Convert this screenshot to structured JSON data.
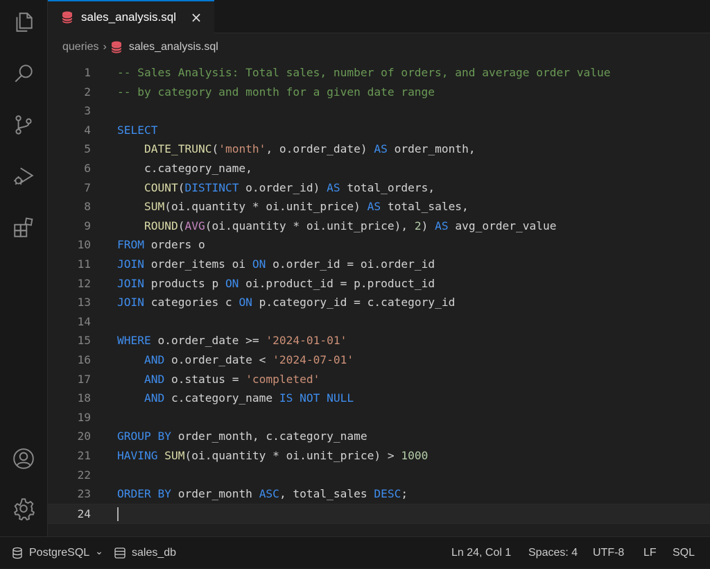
{
  "tab": {
    "filename": "sales_analysis.sql",
    "close_icon": "×"
  },
  "breadcrumb": {
    "folder": "queries",
    "separator": "›",
    "file": "sales_analysis.sql"
  },
  "activity_icons": [
    "explorer-icon",
    "search-icon",
    "source-control-icon",
    "run-debug-icon",
    "extensions-icon",
    "account-icon",
    "settings-gear-icon"
  ],
  "editor": {
    "active_line": 24,
    "lines": [
      {
        "n": "1",
        "tokens": [
          {
            "t": "-- Sales Analysis: Total sales, number of orders, and average order value",
            "c": "cm"
          }
        ]
      },
      {
        "n": "2",
        "tokens": [
          {
            "t": "-- by category and month for a given date range",
            "c": "cm"
          }
        ]
      },
      {
        "n": "3",
        "tokens": []
      },
      {
        "n": "4",
        "tokens": [
          {
            "t": "SELECT",
            "c": "kw"
          }
        ]
      },
      {
        "n": "5",
        "tokens": [
          {
            "t": "    ",
            "c": "id"
          },
          {
            "t": "DATE_TRUNC",
            "c": "fn"
          },
          {
            "t": "(",
            "c": "id"
          },
          {
            "t": "'month'",
            "c": "st"
          },
          {
            "t": ", o.order_date) ",
            "c": "id"
          },
          {
            "t": "AS",
            "c": "kw"
          },
          {
            "t": " order_month,",
            "c": "id"
          }
        ]
      },
      {
        "n": "6",
        "tokens": [
          {
            "t": "    c.category_name,",
            "c": "id"
          }
        ]
      },
      {
        "n": "7",
        "tokens": [
          {
            "t": "    ",
            "c": "id"
          },
          {
            "t": "COUNT",
            "c": "fn"
          },
          {
            "t": "(",
            "c": "id"
          },
          {
            "t": "DISTINCT",
            "c": "kw"
          },
          {
            "t": " o.order_id) ",
            "c": "id"
          },
          {
            "t": "AS",
            "c": "kw"
          },
          {
            "t": " total_orders,",
            "c": "id"
          }
        ]
      },
      {
        "n": "8",
        "tokens": [
          {
            "t": "    ",
            "c": "id"
          },
          {
            "t": "SUM",
            "c": "fn"
          },
          {
            "t": "(oi.quantity * oi.unit_price) ",
            "c": "id"
          },
          {
            "t": "AS",
            "c": "kw"
          },
          {
            "t": " total_sales,",
            "c": "id"
          }
        ]
      },
      {
        "n": "9",
        "tokens": [
          {
            "t": "    ",
            "c": "id"
          },
          {
            "t": "ROUND",
            "c": "fn"
          },
          {
            "t": "(",
            "c": "id"
          },
          {
            "t": "AVG",
            "c": "pk"
          },
          {
            "t": "(oi.quantity * oi.unit_price), ",
            "c": "id"
          },
          {
            "t": "2",
            "c": "nm"
          },
          {
            "t": ") ",
            "c": "id"
          },
          {
            "t": "AS",
            "c": "kw"
          },
          {
            "t": " avg_order_value",
            "c": "id"
          }
        ]
      },
      {
        "n": "10",
        "tokens": [
          {
            "t": "FROM",
            "c": "kw"
          },
          {
            "t": " orders o",
            "c": "id"
          }
        ]
      },
      {
        "n": "11",
        "tokens": [
          {
            "t": "JOIN",
            "c": "kw"
          },
          {
            "t": " order_items oi ",
            "c": "id"
          },
          {
            "t": "ON",
            "c": "kw"
          },
          {
            "t": " o.order_id = oi.order_id",
            "c": "id"
          }
        ]
      },
      {
        "n": "12",
        "tokens": [
          {
            "t": "JOIN",
            "c": "kw"
          },
          {
            "t": " products p ",
            "c": "id"
          },
          {
            "t": "ON",
            "c": "kw"
          },
          {
            "t": " oi.product_id = p.product_id",
            "c": "id"
          }
        ]
      },
      {
        "n": "13",
        "tokens": [
          {
            "t": "JOIN",
            "c": "kw"
          },
          {
            "t": " categories c ",
            "c": "id"
          },
          {
            "t": "ON",
            "c": "kw"
          },
          {
            "t": " p.category_id = c.category_id",
            "c": "id"
          }
        ]
      },
      {
        "n": "14",
        "tokens": []
      },
      {
        "n": "15",
        "tokens": [
          {
            "t": "WHERE",
            "c": "kw"
          },
          {
            "t": " o.order_date >= ",
            "c": "id"
          },
          {
            "t": "'2024-01-01'",
            "c": "st"
          }
        ]
      },
      {
        "n": "16",
        "tokens": [
          {
            "t": "    ",
            "c": "id"
          },
          {
            "t": "AND",
            "c": "kw"
          },
          {
            "t": " o.order_date < ",
            "c": "id"
          },
          {
            "t": "'2024-07-01'",
            "c": "st"
          }
        ]
      },
      {
        "n": "17",
        "tokens": [
          {
            "t": "    ",
            "c": "id"
          },
          {
            "t": "AND",
            "c": "kw"
          },
          {
            "t": " o.status = ",
            "c": "id"
          },
          {
            "t": "'completed'",
            "c": "st"
          }
        ]
      },
      {
        "n": "18",
        "tokens": [
          {
            "t": "    ",
            "c": "id"
          },
          {
            "t": "AND",
            "c": "kw"
          },
          {
            "t": " c.category_name ",
            "c": "id"
          },
          {
            "t": "IS",
            "c": "kw"
          },
          {
            "t": " ",
            "c": "id"
          },
          {
            "t": "NOT",
            "c": "kw"
          },
          {
            "t": " ",
            "c": "id"
          },
          {
            "t": "NULL",
            "c": "kw"
          }
        ]
      },
      {
        "n": "19",
        "tokens": []
      },
      {
        "n": "20",
        "tokens": [
          {
            "t": "GROUP",
            "c": "kw"
          },
          {
            "t": " ",
            "c": "id"
          },
          {
            "t": "BY",
            "c": "kw"
          },
          {
            "t": " order_month, c.category_name",
            "c": "id"
          }
        ]
      },
      {
        "n": "21",
        "tokens": [
          {
            "t": "HAVING",
            "c": "kw"
          },
          {
            "t": " ",
            "c": "id"
          },
          {
            "t": "SUM",
            "c": "fn"
          },
          {
            "t": "(oi.quantity * oi.unit_price) > ",
            "c": "id"
          },
          {
            "t": "1000",
            "c": "nm"
          }
        ]
      },
      {
        "n": "22",
        "tokens": []
      },
      {
        "n": "23",
        "tokens": [
          {
            "t": "ORDER",
            "c": "kw"
          },
          {
            "t": " ",
            "c": "id"
          },
          {
            "t": "BY",
            "c": "kw"
          },
          {
            "t": " order_month ",
            "c": "id"
          },
          {
            "t": "ASC",
            "c": "kw"
          },
          {
            "t": ", total_sales ",
            "c": "id"
          },
          {
            "t": "DESC",
            "c": "kw"
          },
          {
            "t": ";",
            "c": "id"
          }
        ]
      },
      {
        "n": "24",
        "tokens": []
      }
    ]
  },
  "statusbar": {
    "language_server": "PostgreSQL",
    "language_server_chevron": "⌄",
    "database": "sales_db",
    "cursor_position": "Ln 24, Col 1",
    "indentation": "Spaces: 4",
    "encoding": "UTF-8",
    "eol": "LF",
    "language_mode": "SQL"
  },
  "colors": {
    "keyword": "#3f8ef0",
    "function": "#dcdcaa",
    "string": "#ce9178",
    "comment": "#6a9955",
    "number": "#b5cea8",
    "aggregate_pink": "#c586c0",
    "file_icon": "#e05561"
  }
}
